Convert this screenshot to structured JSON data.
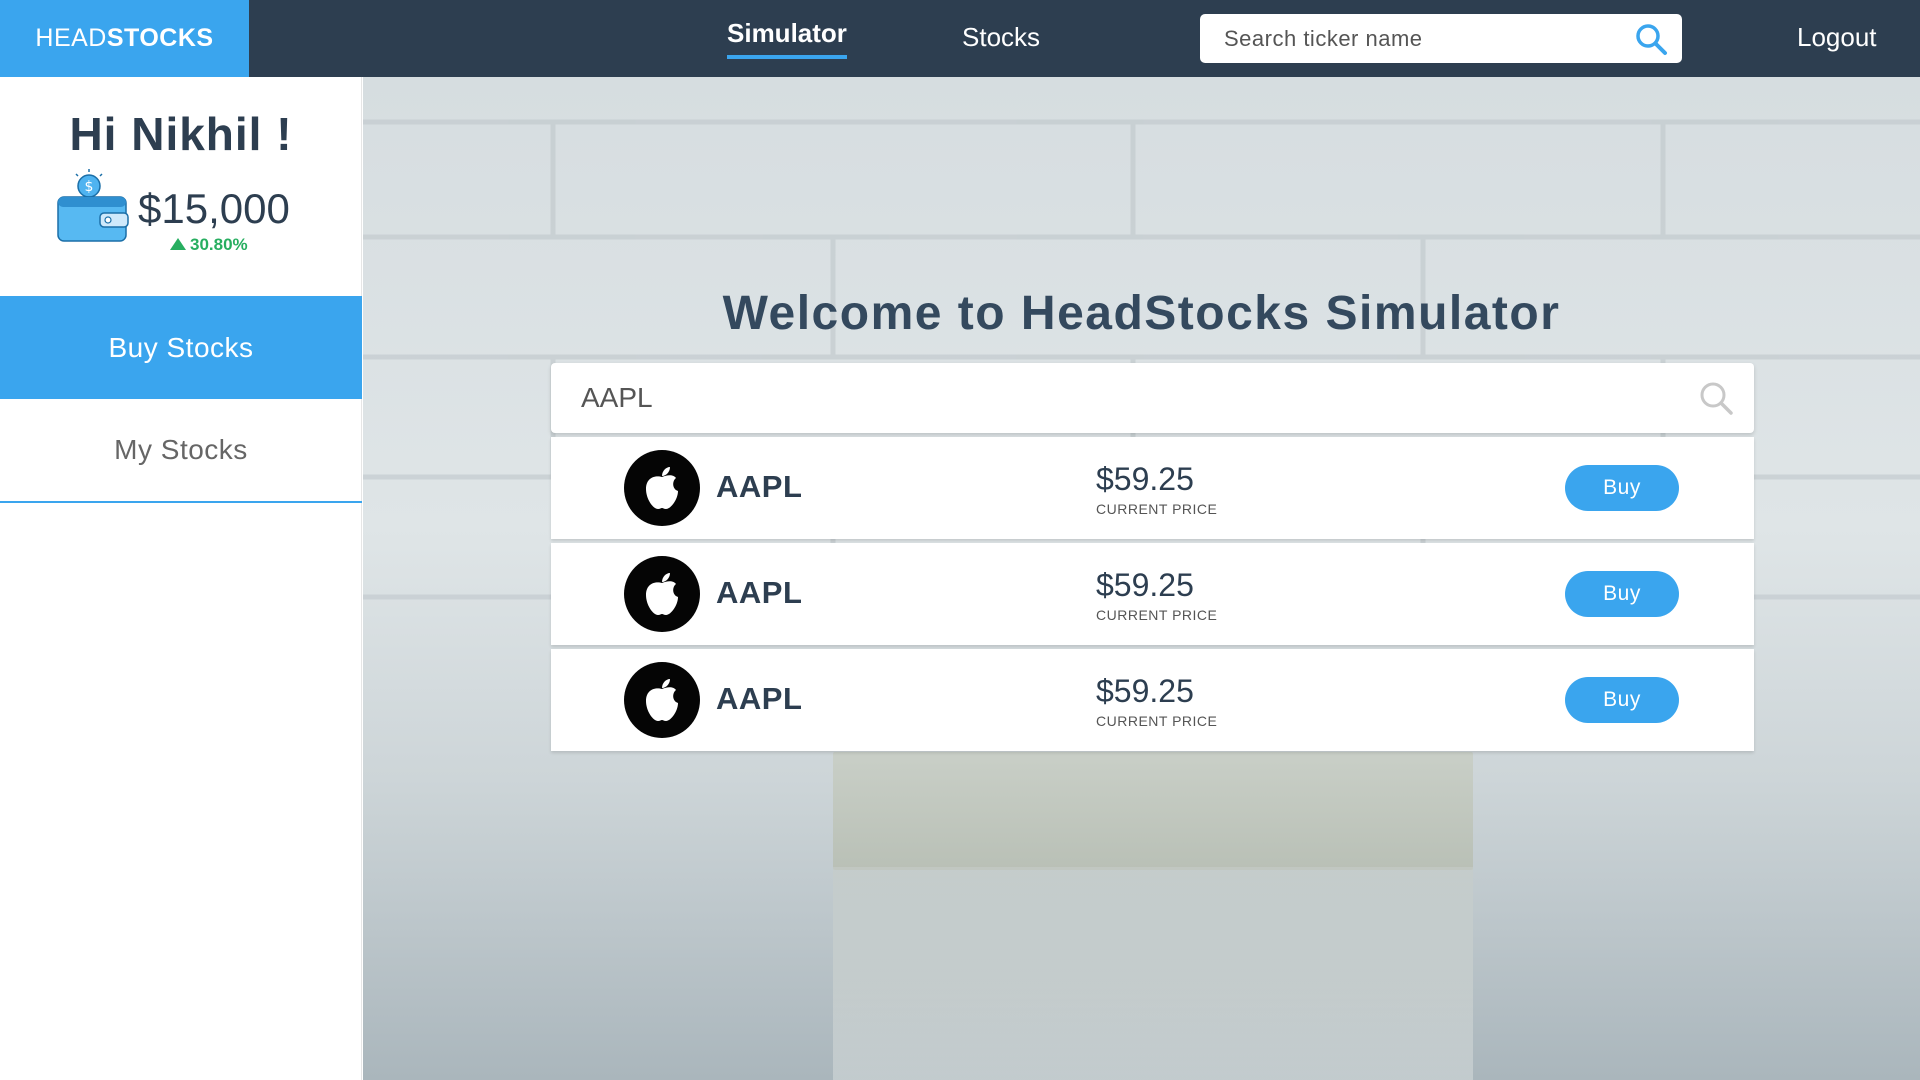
{
  "header": {
    "brand_light": "HEAD",
    "brand_bold": "STOCKS",
    "nav": [
      {
        "label": "Simulator",
        "active": true
      },
      {
        "label": "Stocks",
        "active": false
      }
    ],
    "search_placeholder": "Search ticker name",
    "search_icon": "search-icon",
    "logout_label": "Logout"
  },
  "sidebar": {
    "greeting": "Hi Nikhil !",
    "wallet_icon": "wallet-icon",
    "balance": "$15,000",
    "change": "30.80%",
    "change_direction": "up",
    "items": [
      {
        "label": "Buy Stocks",
        "active": true
      },
      {
        "label": "My Stocks",
        "active": false
      }
    ]
  },
  "main": {
    "title": "Welcome to HeadStocks Simulator",
    "search_value": "AAPL",
    "search_icon": "search-icon",
    "results": [
      {
        "ticker": "AAPL",
        "price": "$59.25",
        "price_label": "CURRENT PRICE",
        "action": "Buy",
        "logo_icon": "apple-logo-icon"
      },
      {
        "ticker": "AAPL",
        "price": "$59.25",
        "price_label": "CURRENT PRICE",
        "action": "Buy",
        "logo_icon": "apple-logo-icon"
      },
      {
        "ticker": "AAPL",
        "price": "$59.25",
        "price_label": "CURRENT PRICE",
        "action": "Buy",
        "logo_icon": "apple-logo-icon"
      }
    ]
  },
  "colors": {
    "accent": "#3aa5ee",
    "navbar": "#2d3e50",
    "positive": "#27ae60"
  }
}
